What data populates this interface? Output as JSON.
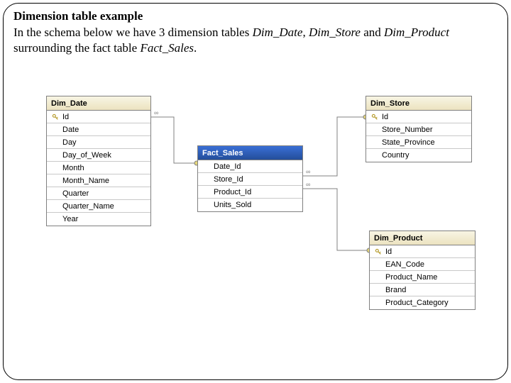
{
  "title": "Dimension table example",
  "intro_plain1": "In the schema below we have 3 dimension tables ",
  "intro_it1": "Dim_Date",
  "intro_sep1": ", ",
  "intro_it2": "Dim_Store",
  "intro_sep2": " and ",
  "intro_it3": "Dim_Product",
  "intro_plain2": " surrounding the fact table ",
  "intro_it4": "Fact_Sales",
  "intro_end": ".",
  "tables": {
    "dim_date": {
      "name": "Dim_Date",
      "fields": [
        {
          "label": "Id",
          "pk": true
        },
        {
          "label": "Date",
          "pk": false
        },
        {
          "label": "Day",
          "pk": false
        },
        {
          "label": "Day_of_Week",
          "pk": false
        },
        {
          "label": "Month",
          "pk": false
        },
        {
          "label": "Month_Name",
          "pk": false
        },
        {
          "label": "Quarter",
          "pk": false
        },
        {
          "label": "Quarter_Name",
          "pk": false
        },
        {
          "label": "Year",
          "pk": false
        }
      ]
    },
    "fact_sales": {
      "name": "Fact_Sales",
      "fields": [
        {
          "label": "Date_Id",
          "pk": false
        },
        {
          "label": "Store_Id",
          "pk": false
        },
        {
          "label": "Product_Id",
          "pk": false
        },
        {
          "label": "Units_Sold",
          "pk": false
        }
      ]
    },
    "dim_store": {
      "name": "Dim_Store",
      "fields": [
        {
          "label": "Id",
          "pk": true
        },
        {
          "label": "Store_Number",
          "pk": false
        },
        {
          "label": "State_Province",
          "pk": false
        },
        {
          "label": "Country",
          "pk": false
        }
      ]
    },
    "dim_product": {
      "name": "Dim_Product",
      "fields": [
        {
          "label": "Id",
          "pk": true
        },
        {
          "label": "EAN_Code",
          "pk": false
        },
        {
          "label": "Product_Name",
          "pk": false
        },
        {
          "label": "Brand",
          "pk": false
        },
        {
          "label": "Product_Category",
          "pk": false
        }
      ]
    }
  },
  "icons": {
    "key": "key-icon"
  }
}
